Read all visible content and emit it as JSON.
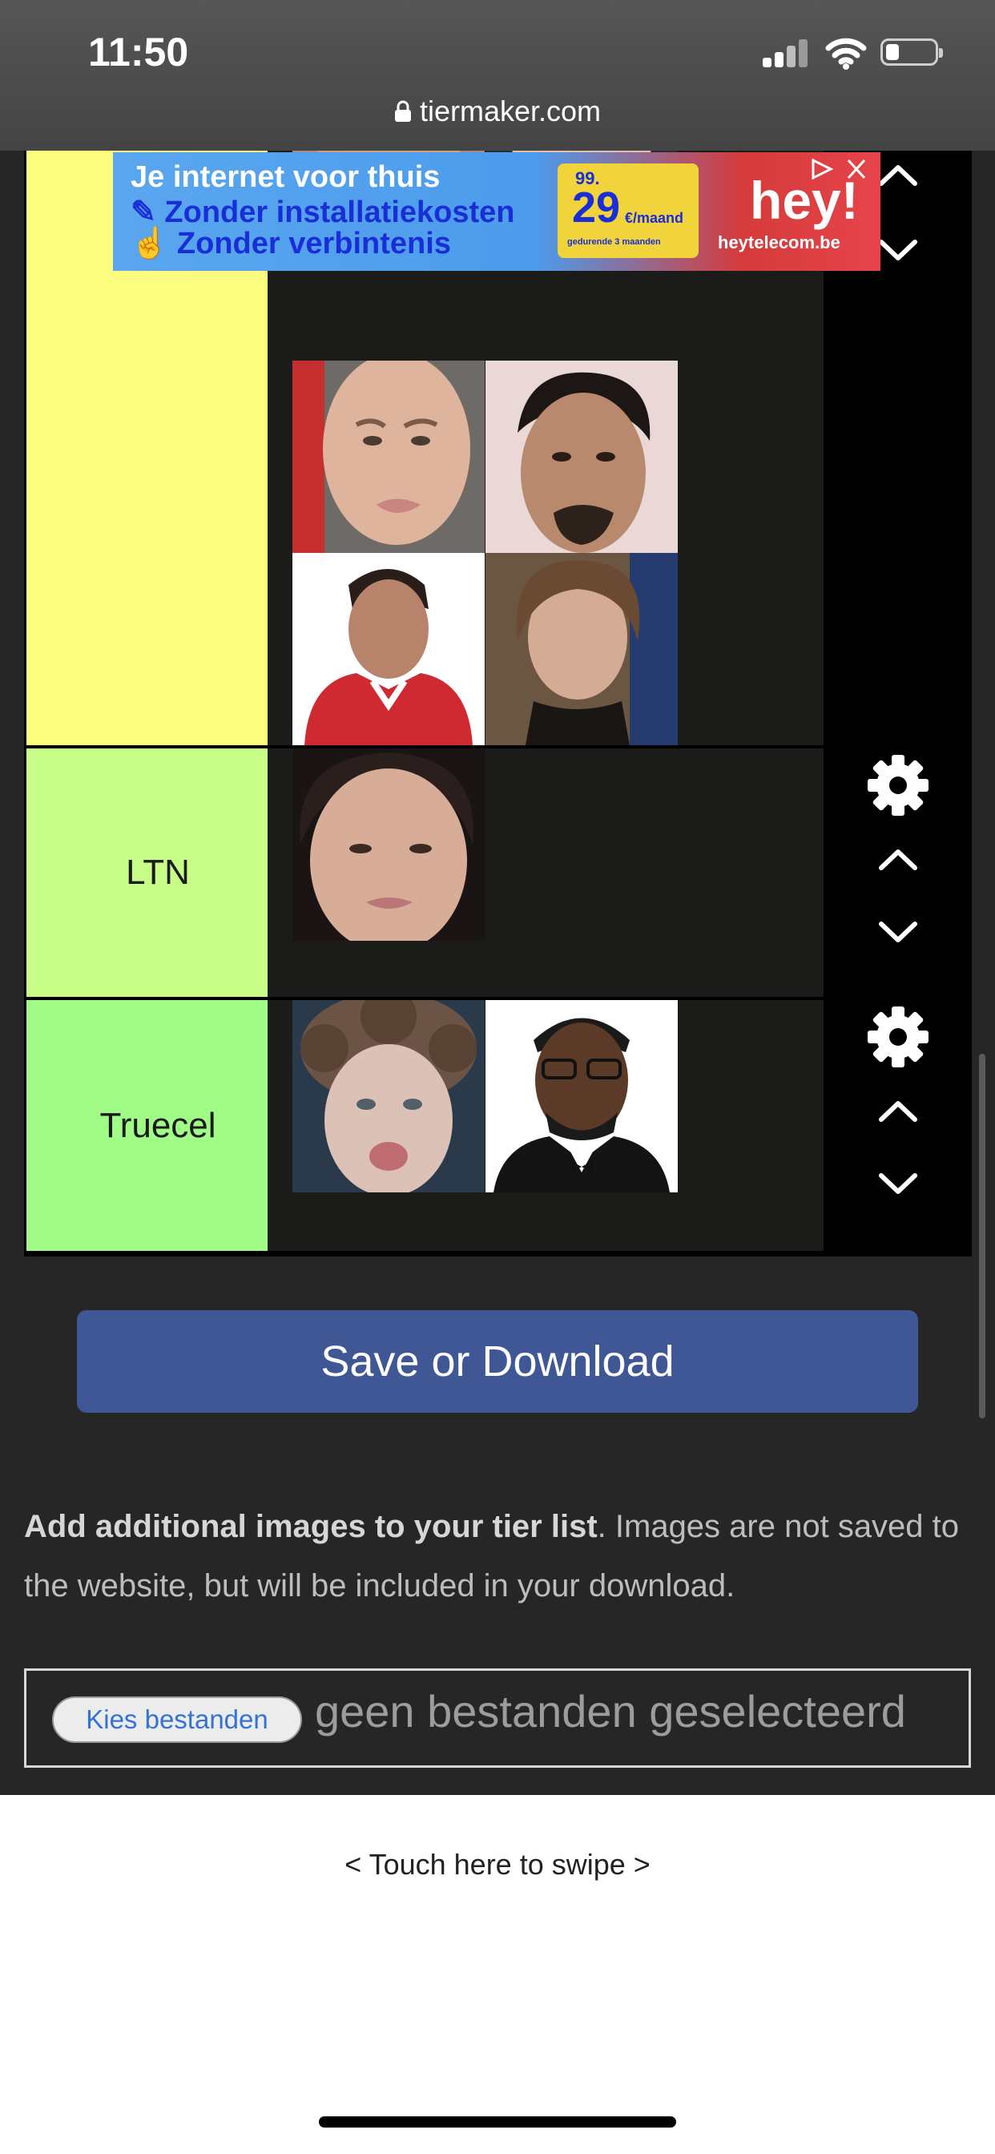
{
  "status_bar": {
    "time": "11:50"
  },
  "browser": {
    "url": "tiermaker.com"
  },
  "ad": {
    "line1": "Je internet voor thuis",
    "line2": "Zonder installatiekosten",
    "line3": "Zonder verbintenis",
    "price_small": "99.",
    "price_big": "29",
    "price_unit": "€/maand",
    "price_note": "gedurende 3 maanden",
    "logo": "hey!",
    "site": "heytelecom.be"
  },
  "tiers": [
    {
      "label": "",
      "color": "#fdfd80",
      "controls": [
        "chevron-up-icon",
        "chevron-down-icon"
      ]
    },
    {
      "label": "LTN",
      "color": "#c8fe88",
      "controls": [
        "gear-icon",
        "chevron-up-icon",
        "chevron-down-icon"
      ]
    },
    {
      "label": "Truecel",
      "color": "#a0fc86",
      "controls": [
        "gear-icon",
        "chevron-up-icon",
        "chevron-down-icon"
      ]
    }
  ],
  "save_button": {
    "label": "Save or Download"
  },
  "info": {
    "bold": "Add additional images to your tier list",
    "rest": ". Images are not saved to the website, but will be included in your download."
  },
  "file_input": {
    "button_label": "Kies bestanden",
    "status": "geen bestanden geselecteerd"
  },
  "swipe_hint": "< Touch here to swipe >",
  "colors": {
    "save_button": "#405796",
    "page_bg": "#262626",
    "item_area": "#1b1c19"
  }
}
